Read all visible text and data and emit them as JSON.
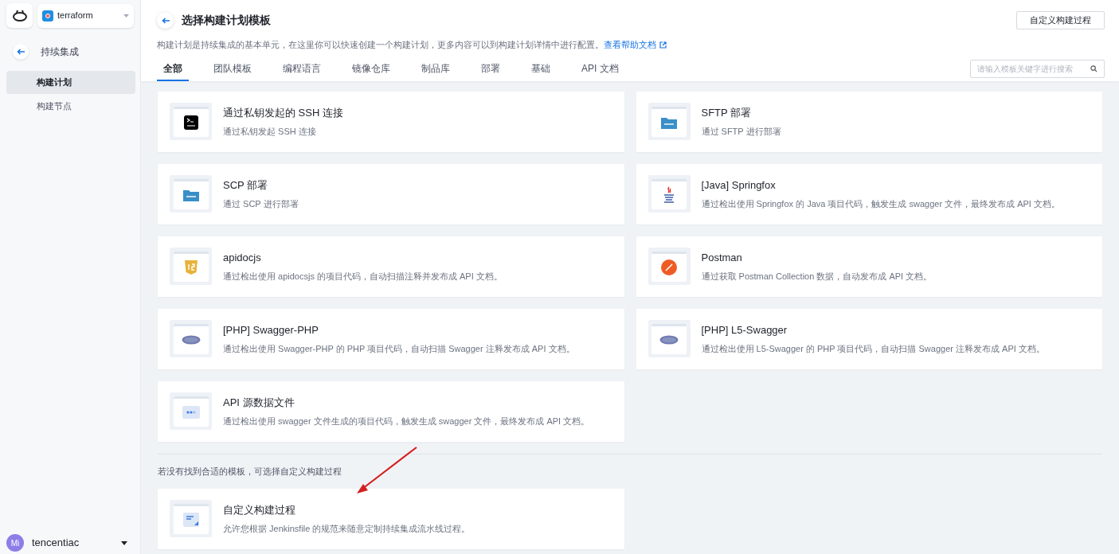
{
  "sidebar": {
    "project": "terraform",
    "back_label": "持续集成",
    "items": [
      {
        "label": "构建计划",
        "selected": true
      },
      {
        "label": "构建节点",
        "selected": false
      }
    ],
    "user": {
      "initials": "Mi",
      "name": "tencentiac"
    }
  },
  "header": {
    "title": "选择构建计划模板",
    "action": "自定义构建过程",
    "description": "构建计划是持续集成的基本单元，在这里你可以快速创建一个构建计划，更多内容可以到构建计划详情中进行配置。",
    "help_link": "查看帮助文档"
  },
  "tabs": [
    {
      "label": "全部",
      "selected": true
    },
    {
      "label": "团队模板",
      "selected": false
    },
    {
      "label": "编程语言",
      "selected": false
    },
    {
      "label": "镜像仓库",
      "selected": false
    },
    {
      "label": "制品库",
      "selected": false
    },
    {
      "label": "部署",
      "selected": false
    },
    {
      "label": "基础",
      "selected": false
    },
    {
      "label": "API 文档",
      "selected": false
    }
  ],
  "search": {
    "placeholder": "请输入模板关键字进行搜索"
  },
  "templates": [
    {
      "kind": "ssh",
      "title": "通过私钥发起的 SSH 连接",
      "description": "通过私钥发起 SSH 连接"
    },
    {
      "kind": "folder",
      "title": "SFTP 部署",
      "description": "通过 SFTP 进行部署"
    },
    {
      "kind": "folder",
      "title": "SCP 部署",
      "description": "通过 SCP 进行部署"
    },
    {
      "kind": "java",
      "title": "[Java] Springfox",
      "description": "通过检出使用 Springfox 的 Java 项目代码，触发生成 swagger 文件，最终发布成 API 文档。"
    },
    {
      "kind": "js",
      "title": "apidocjs",
      "description": "通过检出使用 apidocsjs 的项目代码，自动扫描注释并发布成 API 文档。"
    },
    {
      "kind": "postman",
      "title": "Postman",
      "description": "通过获取 Postman Collection 数据，自动发布成 API 文档。"
    },
    {
      "kind": "php",
      "title": "[PHP] Swagger-PHP",
      "description": "通过检出使用 Swagger-PHP 的 PHP 项目代码，自动扫描 Swagger 注释发布成 API 文档。"
    },
    {
      "kind": "php",
      "title": "[PHP] L5-Swagger",
      "description": "通过检出使用 L5-Swagger 的 PHP 项目代码，自动扫描 Swagger 注释发布成 API 文档。"
    },
    {
      "kind": "api",
      "title": "API 源数据文件",
      "description": "通过检出使用 swagger 文件生成的项目代码，触发生成 swagger 文件，最终发布成 API 文档。"
    }
  ],
  "custom_hint": "若没有找到合适的模板，可选择自定义构建过程",
  "custom_template": {
    "kind": "custom",
    "title": "自定义构建过程",
    "description": "允许您根据 Jenkinsfile 的规范来随意定制持续集成流水线过程。"
  }
}
